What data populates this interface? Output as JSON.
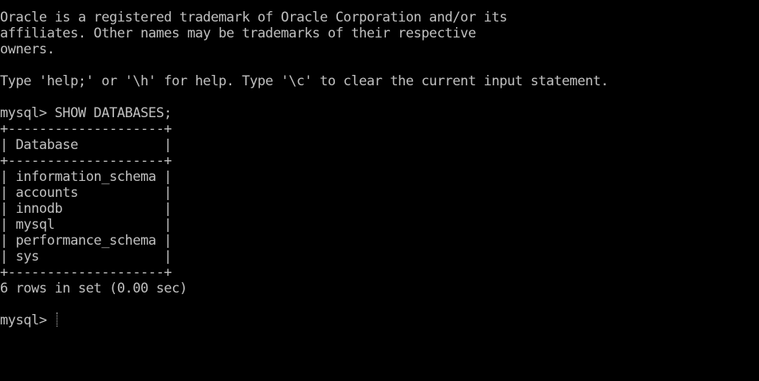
{
  "terminal": {
    "text_color": "#c0c0c0",
    "background_color": "#000000",
    "lines": [
      "Oracle is a registered trademark of Oracle Corporation and/or its",
      "affiliates. Other names may be trademarks of their respective",
      "owners.",
      "",
      "Type 'help;' or '\\h' for help. Type '\\c' to clear the current input statement.",
      "",
      "mysql> SHOW DATABASES;",
      "+--------------------+",
      "| Database           |",
      "+--------------------+",
      "| information_schema |",
      "| accounts           |",
      "| innodb             |",
      "| mysql              |",
      "| performance_schema |",
      "| sys                |",
      "+--------------------+",
      "6 rows in set (0.00 sec)",
      ""
    ],
    "prompt": "mysql> "
  }
}
